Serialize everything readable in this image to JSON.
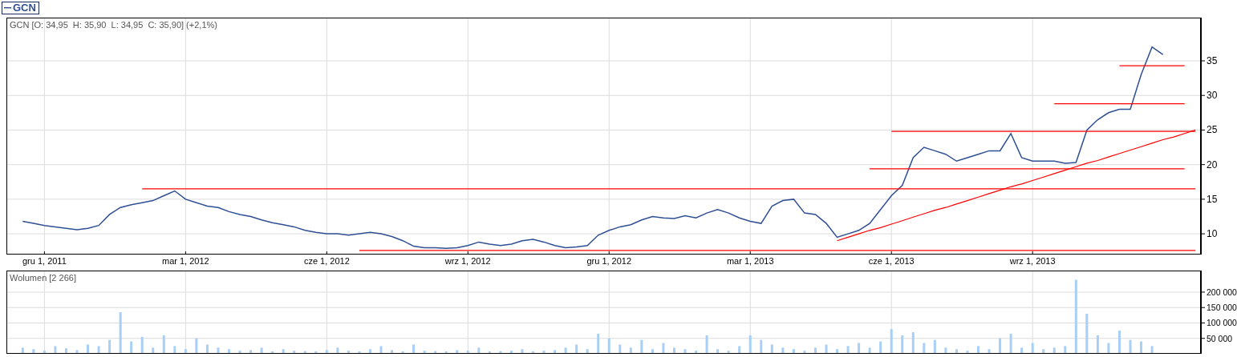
{
  "price_panel": {
    "header": "GCN [O: 34,95  H: 35,90  L: 34,95  C: 35,90] (+2,1%)",
    "chart_data": {
      "type": "line",
      "grid": true,
      "categories": [
        null,
        null,
        null,
        "gru 1, 2011",
        null,
        null,
        null,
        null,
        null,
        null,
        null,
        null,
        null,
        null,
        null,
        null,
        "mar 1, 2012",
        null,
        null,
        null,
        null,
        null,
        null,
        null,
        null,
        null,
        null,
        null,
        null,
        "cze 1, 2012",
        null,
        null,
        null,
        null,
        null,
        null,
        null,
        null,
        null,
        null,
        null,
        null,
        "wrz 1, 2012",
        null,
        null,
        null,
        null,
        null,
        null,
        null,
        null,
        null,
        null,
        null,
        null,
        "gru 1, 2012",
        null,
        null,
        null,
        null,
        null,
        null,
        null,
        null,
        null,
        null,
        null,
        null,
        "mar 1, 2013",
        null,
        null,
        null,
        null,
        null,
        null,
        null,
        null,
        null,
        null,
        null,
        null,
        "cze 1, 2013",
        null,
        null,
        null,
        null,
        null,
        null,
        null,
        null,
        null,
        null,
        null,
        null,
        "wrz 1, 2013",
        null,
        null,
        null,
        null,
        null,
        null,
        null,
        null,
        null,
        null,
        null,
        null,
        null,
        null,
        null
      ],
      "series": [
        {
          "name": "GCN",
          "color": "#2f4f94",
          "values": [
            null,
            11.8,
            11.5,
            11.2,
            11,
            10.8,
            10.6,
            10.8,
            11.2,
            12.8,
            13.8,
            14.2,
            14.5,
            14.8,
            15.5,
            16.2,
            15,
            14.5,
            14,
            13.8,
            13.2,
            12.8,
            12.5,
            12,
            11.6,
            11.3,
            11,
            10.5,
            10.2,
            10,
            10,
            9.8,
            10,
            10.2,
            10,
            9.6,
            9,
            8.2,
            8,
            8,
            7.9,
            8,
            8.3,
            8.8,
            8.5,
            8.3,
            8.5,
            9,
            9.2,
            8.8,
            8.3,
            8,
            8.1,
            8.3,
            9.8,
            10.5,
            11,
            11.3,
            12,
            12.5,
            12.3,
            12.2,
            12.6,
            12.3,
            13,
            13.5,
            13,
            12.3,
            11.8,
            11.5,
            14,
            14.8,
            15,
            13,
            12.8,
            11.5,
            9.5,
            10,
            10.5,
            11.5,
            13.5,
            15.5,
            17,
            21,
            22.5,
            22,
            21.5,
            20.5,
            21,
            21.5,
            22,
            22,
            24.5,
            21,
            20.5,
            20.5,
            20.5,
            20.2,
            20.3,
            25,
            26.5,
            27.5,
            28,
            28,
            33,
            37,
            35.9,
            null,
            null,
            null
          ]
        },
        {
          "color": "#ff0000",
          "values": [
            null,
            null,
            null,
            null,
            null,
            null,
            null,
            null,
            null,
            null,
            null,
            null,
            16.5,
            16.5,
            16.5,
            16.5,
            16.5,
            16.5,
            16.5,
            16.5,
            16.5,
            16.5,
            16.5,
            16.5,
            16.5,
            16.5,
            16.5,
            16.5,
            16.5,
            16.5,
            16.5,
            16.5,
            16.5,
            16.5,
            16.5,
            16.5,
            16.5,
            16.5,
            16.5,
            16.5,
            16.5,
            16.5,
            16.5,
            16.5,
            16.5,
            16.5,
            16.5,
            16.5,
            16.5,
            16.5,
            16.5,
            16.5,
            16.5,
            16.5,
            16.5,
            16.5,
            16.5,
            16.5,
            16.5,
            16.5,
            16.5,
            16.5,
            16.5,
            16.5,
            16.5,
            16.5,
            16.5,
            16.5,
            16.5,
            16.5,
            16.5,
            16.5,
            16.5,
            16.5,
            16.5,
            16.5,
            16.5,
            16.5,
            16.5,
            16.5,
            16.5,
            16.5,
            16.5,
            16.5,
            16.5,
            16.5,
            16.5,
            16.5,
            16.5,
            16.5,
            16.5,
            16.5,
            16.5,
            16.5,
            16.5,
            16.5,
            16.5,
            16.5,
            16.5,
            16.5,
            16.5,
            16.5,
            16.5,
            16.5,
            16.5,
            16.5,
            16.5,
            16.5,
            16.5,
            16.5
          ]
        },
        {
          "color": "#ff0000",
          "values": [
            null,
            null,
            null,
            null,
            null,
            null,
            null,
            null,
            null,
            null,
            null,
            null,
            null,
            null,
            null,
            null,
            null,
            null,
            null,
            null,
            null,
            null,
            null,
            null,
            null,
            null,
            null,
            null,
            null,
            null,
            null,
            null,
            7.6,
            7.6,
            7.6,
            7.6,
            7.6,
            7.6,
            7.6,
            7.6,
            7.6,
            7.6,
            7.6,
            7.6,
            7.6,
            7.6,
            7.6,
            7.6,
            7.6,
            7.6,
            7.6,
            7.6,
            7.6,
            7.6,
            7.6,
            7.6,
            7.6,
            7.6,
            7.6,
            7.6,
            7.6,
            7.6,
            7.6,
            7.6,
            7.6,
            7.6,
            7.6,
            7.6,
            7.6,
            7.6,
            7.6,
            7.6,
            7.6,
            7.6,
            7.6,
            7.6,
            7.6,
            7.6,
            7.6,
            7.6,
            7.6,
            7.6,
            7.6,
            7.6,
            7.6,
            7.6,
            7.6,
            7.6,
            7.6,
            7.6,
            7.6,
            7.6,
            7.6,
            7.6,
            7.6,
            7.6,
            7.6,
            7.6,
            7.6,
            7.6,
            7.6,
            7.6,
            7.6,
            7.6,
            7.6,
            7.6,
            7.6,
            7.6,
            7.6,
            7.6
          ]
        },
        {
          "color": "#ff0000",
          "values": [
            null,
            null,
            null,
            null,
            null,
            null,
            null,
            null,
            null,
            null,
            null,
            null,
            null,
            null,
            null,
            null,
            null,
            null,
            null,
            null,
            null,
            null,
            null,
            null,
            null,
            null,
            null,
            null,
            null,
            null,
            null,
            null,
            null,
            null,
            null,
            null,
            null,
            null,
            null,
            null,
            null,
            null,
            null,
            null,
            null,
            null,
            null,
            null,
            null,
            null,
            null,
            null,
            null,
            null,
            null,
            null,
            null,
            null,
            null,
            null,
            null,
            null,
            null,
            null,
            null,
            null,
            null,
            null,
            null,
            null,
            null,
            null,
            null,
            null,
            null,
            null,
            null,
            null,
            null,
            19.4,
            19.4,
            19.4,
            19.4,
            19.4,
            19.4,
            19.4,
            19.4,
            19.4,
            19.4,
            19.4,
            19.4,
            19.4,
            19.4,
            19.4,
            19.4,
            19.4,
            19.4,
            19.4,
            19.4,
            19.4,
            19.4,
            19.4,
            19.4,
            19.4,
            19.4,
            19.4,
            19.4,
            19.4,
            19.4,
            null
          ]
        },
        {
          "color": "#ff0000",
          "values": [
            null,
            null,
            null,
            null,
            null,
            null,
            null,
            null,
            null,
            null,
            null,
            null,
            null,
            null,
            null,
            null,
            null,
            null,
            null,
            null,
            null,
            null,
            null,
            null,
            null,
            null,
            null,
            null,
            null,
            null,
            null,
            null,
            null,
            null,
            null,
            null,
            null,
            null,
            null,
            null,
            null,
            null,
            null,
            null,
            null,
            null,
            null,
            null,
            null,
            null,
            null,
            null,
            null,
            null,
            null,
            null,
            null,
            null,
            null,
            null,
            null,
            null,
            null,
            null,
            null,
            null,
            null,
            null,
            null,
            null,
            null,
            null,
            null,
            null,
            null,
            null,
            null,
            null,
            null,
            null,
            null,
            24.8,
            24.8,
            24.8,
            24.8,
            24.8,
            24.8,
            24.8,
            24.8,
            24.8,
            24.8,
            24.8,
            24.8,
            24.8,
            24.8,
            24.8,
            24.8,
            24.8,
            24.8,
            24.8,
            24.8,
            24.8,
            24.8,
            24.8,
            24.8,
            24.8,
            24.8,
            24.8,
            24.8,
            24.8
          ]
        },
        {
          "color": "#ff0000",
          "values": [
            null,
            null,
            null,
            null,
            null,
            null,
            null,
            null,
            null,
            null,
            null,
            null,
            null,
            null,
            null,
            null,
            null,
            null,
            null,
            null,
            null,
            null,
            null,
            null,
            null,
            null,
            null,
            null,
            null,
            null,
            null,
            null,
            null,
            null,
            null,
            null,
            null,
            null,
            null,
            null,
            null,
            null,
            null,
            null,
            null,
            null,
            null,
            null,
            null,
            null,
            null,
            null,
            null,
            null,
            null,
            null,
            null,
            null,
            null,
            null,
            null,
            null,
            null,
            null,
            null,
            null,
            null,
            null,
            null,
            null,
            null,
            null,
            null,
            null,
            null,
            null,
            null,
            null,
            null,
            null,
            null,
            null,
            null,
            null,
            null,
            null,
            null,
            null,
            null,
            null,
            null,
            null,
            null,
            null,
            null,
            null,
            28.8,
            28.8,
            28.8,
            28.8,
            28.8,
            28.8,
            28.8,
            28.8,
            28.8,
            28.8,
            28.8,
            28.8,
            28.8,
            null
          ]
        },
        {
          "color": "#ff0000",
          "values": [
            null,
            null,
            null,
            null,
            null,
            null,
            null,
            null,
            null,
            null,
            null,
            null,
            null,
            null,
            null,
            null,
            null,
            null,
            null,
            null,
            null,
            null,
            null,
            null,
            null,
            null,
            null,
            null,
            null,
            null,
            null,
            null,
            null,
            null,
            null,
            null,
            null,
            null,
            null,
            null,
            null,
            null,
            null,
            null,
            null,
            null,
            null,
            null,
            null,
            null,
            null,
            null,
            null,
            null,
            null,
            null,
            null,
            null,
            null,
            null,
            null,
            null,
            null,
            null,
            null,
            null,
            null,
            null,
            null,
            null,
            null,
            null,
            null,
            null,
            null,
            null,
            null,
            null,
            null,
            null,
            null,
            null,
            null,
            null,
            null,
            null,
            null,
            null,
            null,
            null,
            null,
            null,
            null,
            null,
            null,
            null,
            null,
            null,
            null,
            null,
            null,
            null,
            34.3,
            34.3,
            34.3,
            34.3,
            34.3,
            34.3,
            34.3,
            null
          ]
        },
        {
          "color": "#ff0000",
          "values": [
            null,
            null,
            null,
            null,
            null,
            null,
            null,
            null,
            null,
            null,
            null,
            null,
            null,
            null,
            null,
            null,
            null,
            null,
            null,
            null,
            null,
            null,
            null,
            null,
            null,
            null,
            null,
            null,
            null,
            null,
            null,
            null,
            null,
            null,
            null,
            null,
            null,
            null,
            null,
            null,
            null,
            null,
            null,
            null,
            null,
            null,
            null,
            null,
            null,
            null,
            null,
            null,
            null,
            null,
            null,
            null,
            null,
            null,
            null,
            null,
            null,
            null,
            null,
            null,
            null,
            null,
            null,
            null,
            null,
            null,
            null,
            null,
            null,
            null,
            null,
            null,
            9,
            9.5,
            10,
            10.5,
            10.9,
            11.4,
            11.9,
            12.4,
            12.9,
            13.4,
            13.8,
            14.3,
            14.8,
            15.3,
            15.8,
            16.3,
            16.8,
            17.2,
            17.7,
            18.2,
            18.7,
            19.2,
            19.7,
            20.2,
            20.6,
            21.1,
            21.6,
            22.1,
            22.6,
            23.1,
            23.6,
            24,
            24.5,
            25
          ]
        }
      ],
      "ylim": [
        7,
        41.25
      ],
      "yticks": [
        10,
        15,
        20,
        25,
        30,
        35
      ]
    }
  },
  "volume_panel": {
    "chart_data": {
      "type": "bar",
      "title": "Wolumen [2 266]",
      "grid": true,
      "categories": [
        null,
        null,
        null,
        null,
        null,
        null,
        null,
        null,
        null,
        null,
        null,
        null,
        null,
        null,
        null,
        null,
        null,
        null,
        null,
        null,
        null,
        null,
        null,
        null,
        null,
        null,
        null,
        null,
        null,
        null,
        null,
        null,
        null,
        null,
        null,
        null,
        null,
        null,
        null,
        null,
        null,
        null,
        null,
        null,
        null,
        null,
        null,
        null,
        null,
        null,
        null,
        null,
        null,
        null,
        null,
        null,
        null,
        null,
        null,
        null,
        null,
        null,
        null,
        null,
        null,
        null,
        null,
        null,
        null,
        null,
        null,
        null,
        null,
        null,
        null,
        null,
        null,
        null,
        null,
        null,
        null,
        null,
        null,
        null,
        null,
        null,
        null,
        null,
        null,
        null,
        null,
        null,
        null,
        null,
        null,
        null,
        null,
        null,
        null,
        null,
        null,
        null,
        null,
        null,
        null,
        null,
        null,
        null,
        null,
        null
      ],
      "series": [
        {
          "color": "#a8cff5",
          "values": [
            null,
            20000,
            15000,
            10000,
            25000,
            18000,
            12000,
            30000,
            25000,
            45000,
            135000,
            40000,
            55000,
            20000,
            60000,
            25000,
            15000,
            50000,
            30000,
            20000,
            15000,
            10000,
            12000,
            20000,
            8000,
            15000,
            10000,
            9000,
            8000,
            12000,
            20000,
            10000,
            8000,
            15000,
            25000,
            12000,
            8000,
            30000,
            10000,
            9000,
            8000,
            12000,
            10000,
            20000,
            8000,
            9000,
            10000,
            15000,
            8000,
            10000,
            12000,
            20000,
            30000,
            15000,
            65000,
            50000,
            30000,
            20000,
            45000,
            15000,
            35000,
            20000,
            15000,
            10000,
            60000,
            15000,
            10000,
            25000,
            60000,
            45000,
            30000,
            20000,
            15000,
            10000,
            20000,
            30000,
            15000,
            25000,
            35000,
            20000,
            40000,
            80000,
            60000,
            70000,
            35000,
            45000,
            20000,
            15000,
            10000,
            25000,
            15000,
            50000,
            65000,
            20000,
            35000,
            15000,
            20000,
            25000,
            240000,
            130000,
            60000,
            35000,
            75000,
            45000,
            40000,
            25000,
            null,
            null,
            null,
            null
          ]
        }
      ],
      "ylim": [
        0,
        270000
      ],
      "yticks": [
        {
          "value": 50000,
          "label": "50 000"
        },
        {
          "value": 100000,
          "label": "100 000"
        },
        {
          "value": 150000,
          "label": "150 000"
        },
        {
          "value": 200000,
          "label": "200 000"
        }
      ]
    }
  }
}
